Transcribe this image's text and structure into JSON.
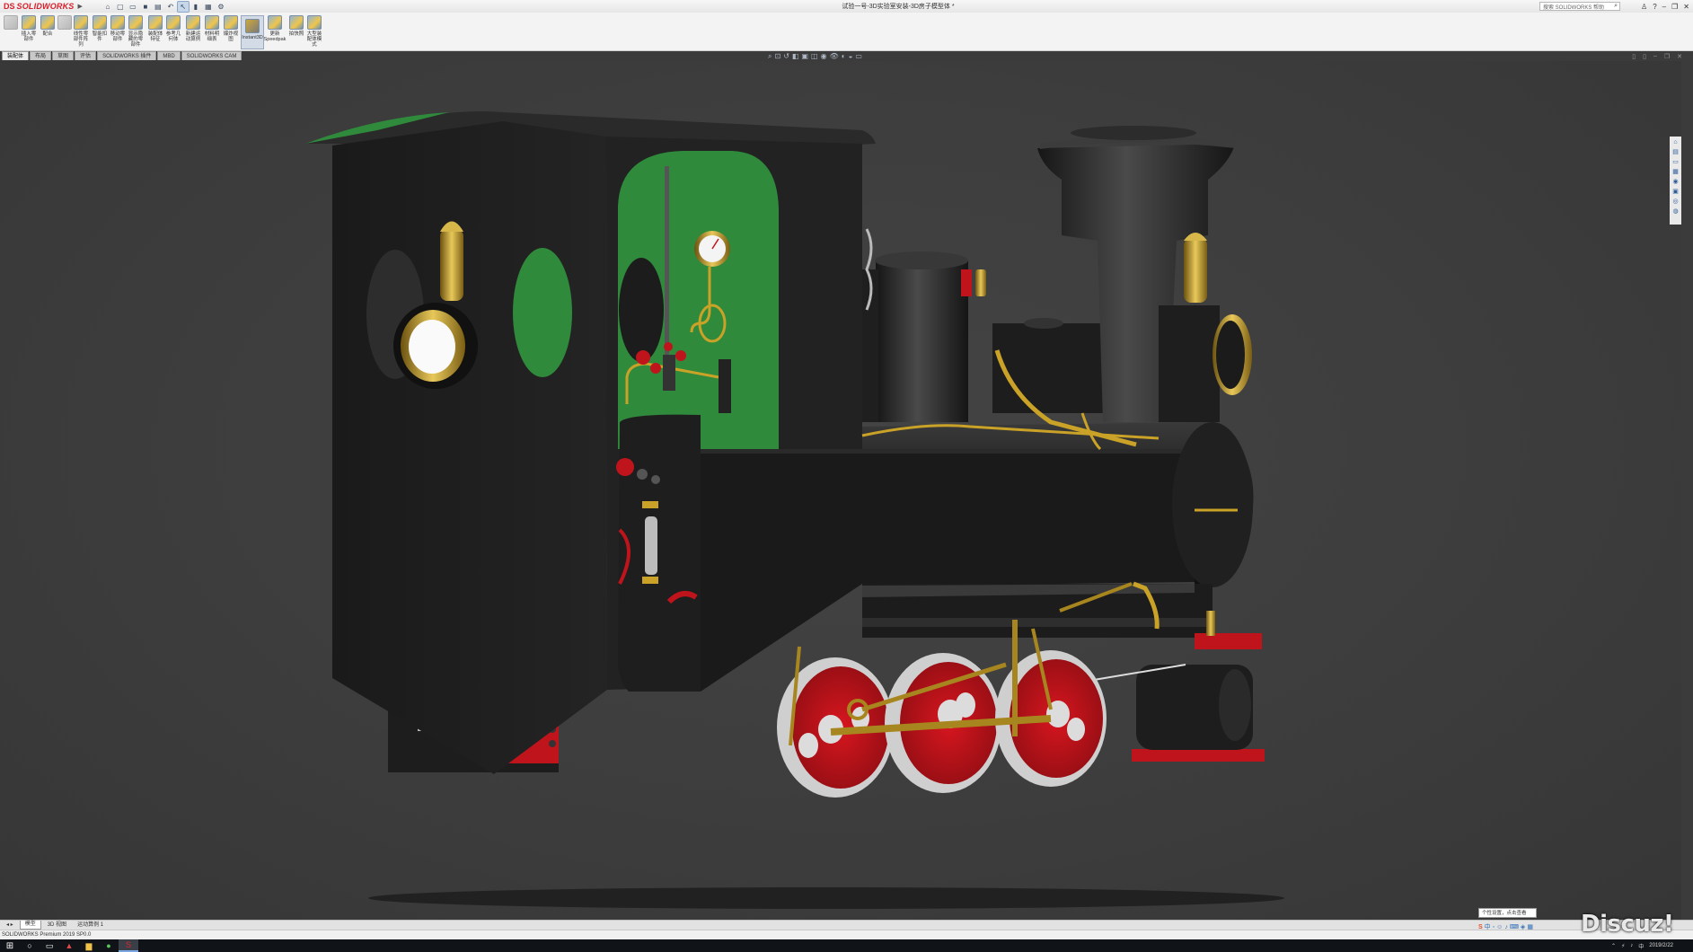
{
  "app": {
    "name": "SOLIDWORKS",
    "document_title": "试验一号-3D实验室安装-3D房子模型体 *"
  },
  "titlebar": {
    "search_placeholder": "搜索 SOLIDWORKS 帮助",
    "help_label": "?"
  },
  "command_manager": {
    "buttons": [
      {
        "label": "",
        "dim": true
      },
      {
        "label": "插入零部件",
        "dim": false
      },
      {
        "label": "配合",
        "dim": false
      },
      {
        "label": "",
        "dim": true
      },
      {
        "label": "线性零部件阵列",
        "dim": false
      },
      {
        "label": "智能扣件",
        "dim": false
      },
      {
        "label": "移动零部件",
        "dim": false
      },
      {
        "label": "显示隐藏的零部件",
        "dim": false
      },
      {
        "label": "装配体特征",
        "dim": false
      },
      {
        "label": "参考几何体",
        "dim": false
      },
      {
        "label": "新建运动算例",
        "dim": false
      },
      {
        "label": "材料明细表",
        "dim": false
      },
      {
        "label": "爆炸视图",
        "dim": false
      },
      {
        "label": "Instant3D",
        "dim": false,
        "active": true
      },
      {
        "label": "更新Speedpak",
        "dim": false
      },
      {
        "label": "拍快照",
        "dim": false
      },
      {
        "label": "大型装配体模式",
        "dim": false
      }
    ]
  },
  "tabs": [
    "装配体",
    "布局",
    "草图",
    "评估",
    "SOLIDWORKS 插件",
    "MBD",
    "SOLIDWORKS CAM"
  ],
  "active_tab": "装配体",
  "bottom_tabs": [
    "模型",
    "3D 视图",
    "运动算例 1"
  ],
  "active_bottom_tab": "模型",
  "status_text": "SOLIDWORKS Premium 2019 SP0.0",
  "toast_text": "个性设置，点击查看",
  "watermark": "Discuz!",
  "clock": {
    "time": "",
    "date": "2019/2/22"
  },
  "colors": {
    "viewport_bg": "#3d3d3d",
    "cab_green": "#2f8a3c",
    "wheel_red": "#c0141c",
    "brass": "#c9a227",
    "body_black": "#1c1c1c"
  }
}
